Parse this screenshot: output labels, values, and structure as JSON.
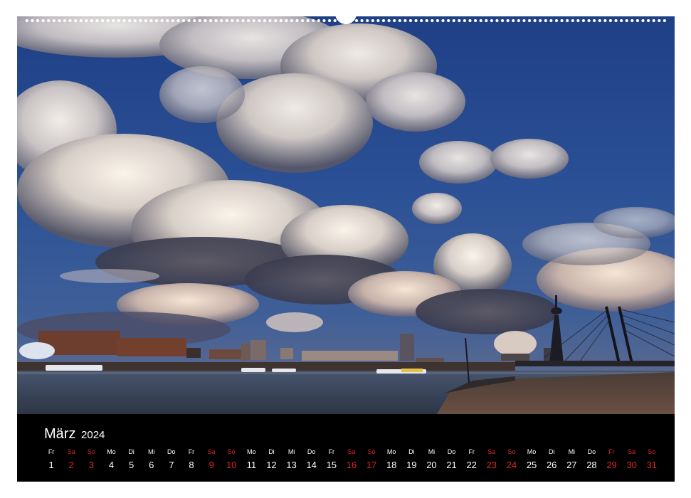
{
  "calendar": {
    "month": "März",
    "year": "2024",
    "weekend_color": "#d9242b",
    "text_color": "#ffffff",
    "days": [
      {
        "wd": "Fr",
        "num": "1",
        "weekend": false
      },
      {
        "wd": "Sa",
        "num": "2",
        "weekend": true
      },
      {
        "wd": "So",
        "num": "3",
        "weekend": true
      },
      {
        "wd": "Mo",
        "num": "4",
        "weekend": false
      },
      {
        "wd": "Di",
        "num": "5",
        "weekend": false
      },
      {
        "wd": "Mi",
        "num": "6",
        "weekend": false
      },
      {
        "wd": "Do",
        "num": "7",
        "weekend": false
      },
      {
        "wd": "Fr",
        "num": "8",
        "weekend": false
      },
      {
        "wd": "Sa",
        "num": "9",
        "weekend": true
      },
      {
        "wd": "So",
        "num": "10",
        "weekend": true
      },
      {
        "wd": "Mo",
        "num": "11",
        "weekend": false
      },
      {
        "wd": "Di",
        "num": "12",
        "weekend": false
      },
      {
        "wd": "Mi",
        "num": "13",
        "weekend": false
      },
      {
        "wd": "Do",
        "num": "14",
        "weekend": false
      },
      {
        "wd": "Fr",
        "num": "15",
        "weekend": false
      },
      {
        "wd": "Sa",
        "num": "16",
        "weekend": true
      },
      {
        "wd": "So",
        "num": "17",
        "weekend": true
      },
      {
        "wd": "Mo",
        "num": "18",
        "weekend": false
      },
      {
        "wd": "Di",
        "num": "19",
        "weekend": false
      },
      {
        "wd": "Mi",
        "num": "20",
        "weekend": false
      },
      {
        "wd": "Do",
        "num": "21",
        "weekend": false
      },
      {
        "wd": "Fr",
        "num": "22",
        "weekend": false
      },
      {
        "wd": "Sa",
        "num": "23",
        "weekend": true
      },
      {
        "wd": "So",
        "num": "24",
        "weekend": true
      },
      {
        "wd": "Mo",
        "num": "25",
        "weekend": false
      },
      {
        "wd": "Di",
        "num": "26",
        "weekend": false
      },
      {
        "wd": "Mi",
        "num": "27",
        "weekend": false
      },
      {
        "wd": "Do",
        "num": "28",
        "weekend": false
      },
      {
        "wd": "Fr",
        "num": "29",
        "weekend": true
      },
      {
        "wd": "Sa",
        "num": "30",
        "weekend": true
      },
      {
        "wd": "So",
        "num": "31",
        "weekend": true
      }
    ]
  }
}
